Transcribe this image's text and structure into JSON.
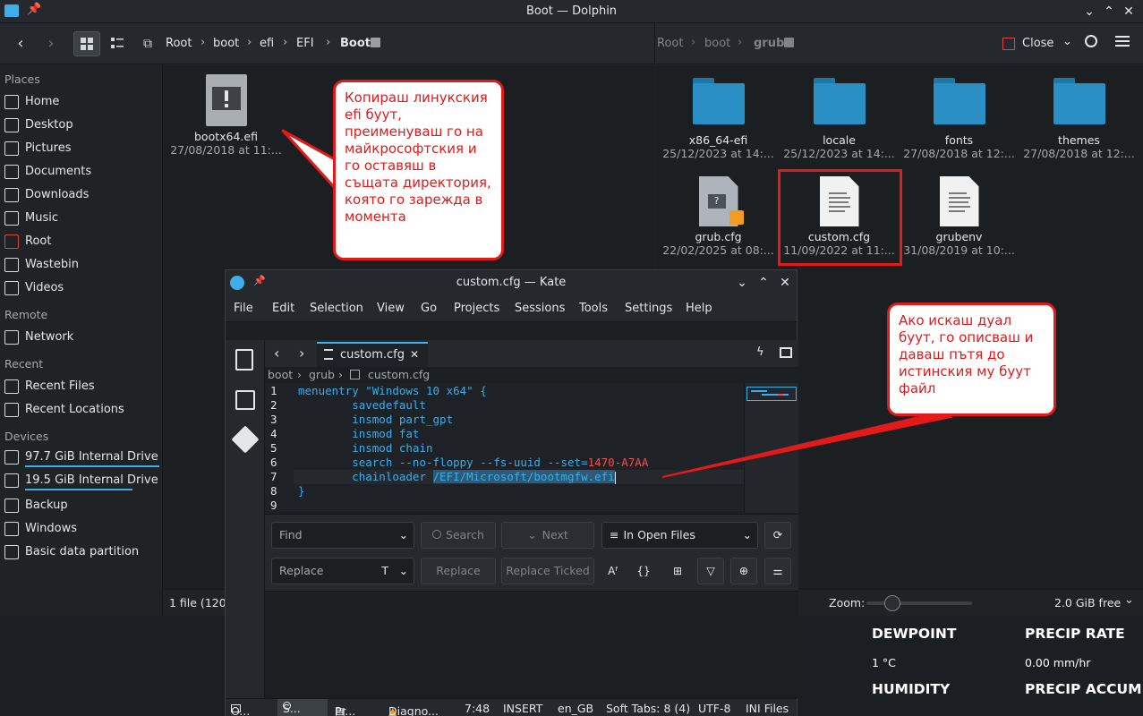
{
  "dolphin": {
    "window_title": "Boot — Dolphin",
    "breadcrumb_left": [
      "Root",
      "boot",
      "efi",
      "EFI",
      "Boot"
    ],
    "breadcrumb_right": [
      "Root",
      "boot",
      "grub"
    ],
    "close_label": "Close",
    "sidebar": {
      "places_header": "Places",
      "places": [
        "Home",
        "Desktop",
        "Pictures",
        "Documents",
        "Downloads",
        "Music",
        "Root",
        "Wastebin",
        "Videos"
      ],
      "remote_header": "Remote",
      "remote": [
        "Network"
      ],
      "recent_header": "Recent",
      "recent": [
        "Recent Files",
        "Recent Locations"
      ],
      "devices_header": "Devices",
      "devices": [
        "97.7 GiB Internal Drive ...",
        "19.5 GiB Internal Drive ...",
        "Backup",
        "Windows",
        "Basic data partition"
      ]
    },
    "left_files": [
      {
        "name": "bootx64.efi",
        "date": "27/08/2018 at 11:..."
      }
    ],
    "right_files": [
      {
        "name": "x86_64-efi",
        "date": "25/12/2023 at 14:...",
        "kind": "folder"
      },
      {
        "name": "locale",
        "date": "25/12/2023 at 14:...",
        "kind": "folder"
      },
      {
        "name": "fonts",
        "date": "27/08/2018 at 12:...",
        "kind": "folder"
      },
      {
        "name": "themes",
        "date": "27/08/2018 at 12:...",
        "kind": "folder"
      },
      {
        "name": "grub.cfg",
        "date": "22/02/2025 at 08:...",
        "kind": "locked"
      },
      {
        "name": "custom.cfg",
        "date": "11/09/2022 at 11:...",
        "kind": "text"
      },
      {
        "name": "grubenv",
        "date": "31/08/2019 at 10:...",
        "kind": "text"
      }
    ],
    "status_left": "1 file (120",
    "zoom_label": "Zoom:",
    "zoom_level": 0.2,
    "free_space": "2.0 GiB free"
  },
  "callouts": {
    "top": "Копираш линукския efi буут, преименуваш го на майкрософтския и го оставяш в същата директория, която го зарежда в момента",
    "right": "Ако искаш дуал буут, го описваш и даваш пътя до истинския му буут файл"
  },
  "kate": {
    "window_title": "custom.cfg — Kate",
    "menu": [
      "File",
      "Edit",
      "Selection",
      "View",
      "Go",
      "Projects",
      "Sessions",
      "Tools",
      "Settings",
      "Help"
    ],
    "tab_label": "custom.cfg",
    "crumbs": [
      "boot",
      "grub",
      "custom.cfg"
    ],
    "code": [
      "menuentry \"Windows 10 x64\" {",
      "        savedefault",
      "        insmod part_gpt",
      "        insmod fat",
      "        insmod chain",
      "        search --no-floppy --fs-uuid --set=",
      "        chainloader ",
      "}",
      ""
    ],
    "uuid": "1470-A7AA",
    "selected_path": "/EFI/Microsoft/bootmgfw.efi",
    "find": {
      "find_placeholder": "Find",
      "search_label": "Search",
      "next_label": "Next",
      "scope": "In Open Files",
      "replace_placeholder": "Replace",
      "replace_label": "Replace",
      "replace_ticked_label": "Replace Ticked"
    },
    "status": {
      "tab1": "O...",
      "tab2": "S...",
      "tab3": "Pr...",
      "tab4": "Diagno...",
      "position": "7:48",
      "mode": "INSERT",
      "lang": "en_GB",
      "indent": "Soft Tabs: 8 (4)",
      "encoding": "UTF-8",
      "filetype": "INI Files"
    }
  },
  "weather": {
    "dewpoint_label": "DEWPOINT",
    "dewpoint_value": "1 °C",
    "precip_rate_label": "PRECIP RATE",
    "precip_rate_value": "0.00 mm/hr",
    "humidity_label": "HUMIDITY",
    "precip_accum_label": "PRECIP ACCUM"
  },
  "colors": {
    "accent": "#3daee9",
    "highlight_red": "#e21a1a",
    "window_bg": "#202326"
  }
}
